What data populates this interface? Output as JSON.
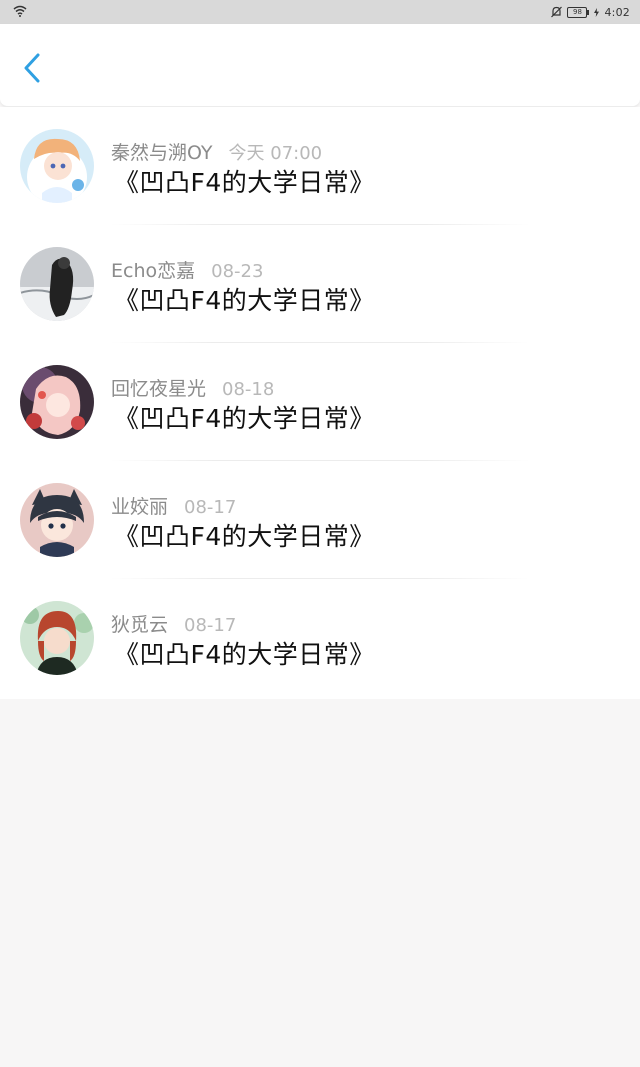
{
  "status_bar": {
    "battery": "98",
    "time": "4:02"
  },
  "header": {
    "back_icon": "chevron-left-icon",
    "accent": "#2fa0e2"
  },
  "comments": [
    {
      "user": "秦然与溯OY",
      "date": "今天 07:00",
      "title": "《凹凸F4的大学日常》"
    },
    {
      "user": "Echo恋嘉",
      "date": "08-23",
      "title": "《凹凸F4的大学日常》"
    },
    {
      "user": "回忆夜星光",
      "date": "08-18",
      "title": "《凹凸F4的大学日常》"
    },
    {
      "user": "业姣丽",
      "date": "08-17",
      "title": "《凹凸F4的大学日常》"
    },
    {
      "user": "狄觅云",
      "date": "08-17",
      "title": "《凹凸F4的大学日常》"
    }
  ]
}
